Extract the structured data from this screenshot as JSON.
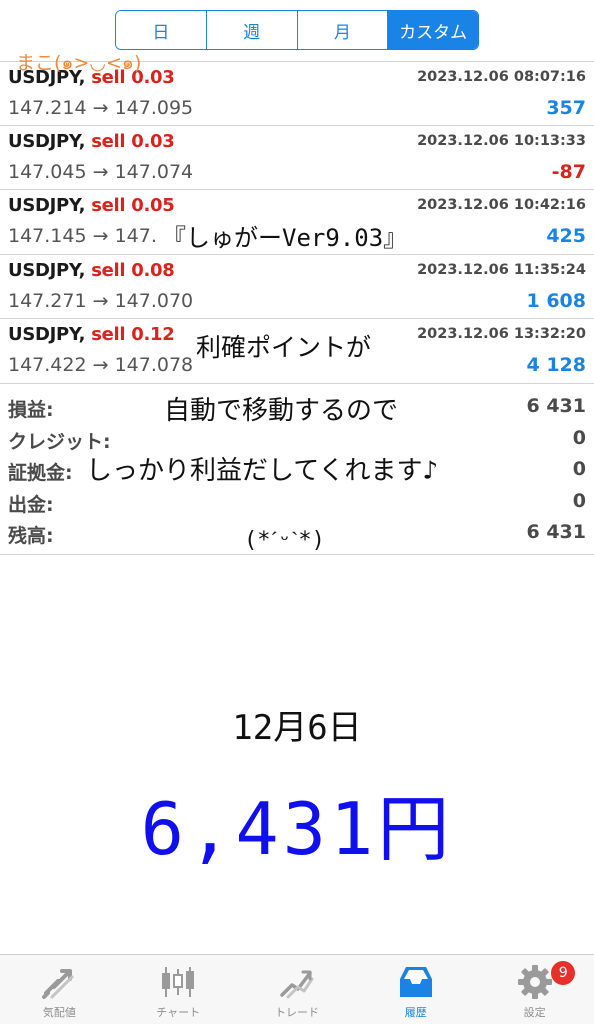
{
  "tabs_period": [
    "日",
    "週",
    "月",
    "カスタム"
  ],
  "active_period": "カスタム",
  "brand_overlay": "まこ(๑>◡<๑)",
  "trades": [
    {
      "symbol": "USDJPY,",
      "side": "sell 0.03",
      "time": "2023.12.06 08:07:16",
      "prices": "147.214 → 147.095",
      "profit": "357",
      "profit_sign": "pos"
    },
    {
      "symbol": "USDJPY,",
      "side": "sell 0.03",
      "time": "2023.12.06 10:13:33",
      "prices": "147.045 → 147.074",
      "profit": "-87",
      "profit_sign": "neg"
    },
    {
      "symbol": "USDJPY,",
      "side": "sell 0.05",
      "time": "2023.12.06 10:42:16",
      "prices": "147.145 → 147.060",
      "profit": "425",
      "profit_sign": "pos"
    },
    {
      "symbol": "USDJPY,",
      "side": "sell 0.08",
      "time": "2023.12.06 11:35:24",
      "prices": "147.271 → 147.070",
      "profit": "1 608",
      "profit_sign": "pos"
    },
    {
      "symbol": "USDJPY,",
      "side": "sell 0.12",
      "time": "2023.12.06 13:32:20",
      "prices": "147.422 → 147.078",
      "profit": "4 128",
      "profit_sign": "pos"
    }
  ],
  "summary": [
    {
      "label": "損益:",
      "value": "6 431"
    },
    {
      "label": "クレジット:",
      "value": "0"
    },
    {
      "label": "証拠金:",
      "value": "0"
    },
    {
      "label": "出金:",
      "value": "0"
    },
    {
      "label": "残高:",
      "value": "6 431"
    }
  ],
  "overlay_text": [
    "『しゅがーVer9.03』",
    "利確ポイントが",
    "自動で移動するので",
    "しっかり利益だしてくれます♪",
    "(*ˊᵕˋ*)"
  ],
  "date_handwritten": "12月6日",
  "amount_handwritten": "6,431円",
  "tabbar": [
    {
      "label": "気配値",
      "icon": "quotes-icon"
    },
    {
      "label": "チャート",
      "icon": "chart-icon"
    },
    {
      "label": "トレード",
      "icon": "trade-icon"
    },
    {
      "label": "履歴",
      "icon": "history-icon",
      "active": true
    },
    {
      "label": "設定",
      "icon": "gear-icon",
      "badge": "9"
    }
  ],
  "colors": {
    "accent": "#1a84e6",
    "sell": "#d9241c",
    "handwriting_blue": "#1010ee",
    "brand_orange": "#f08a3c",
    "badge": "#e5312a"
  }
}
